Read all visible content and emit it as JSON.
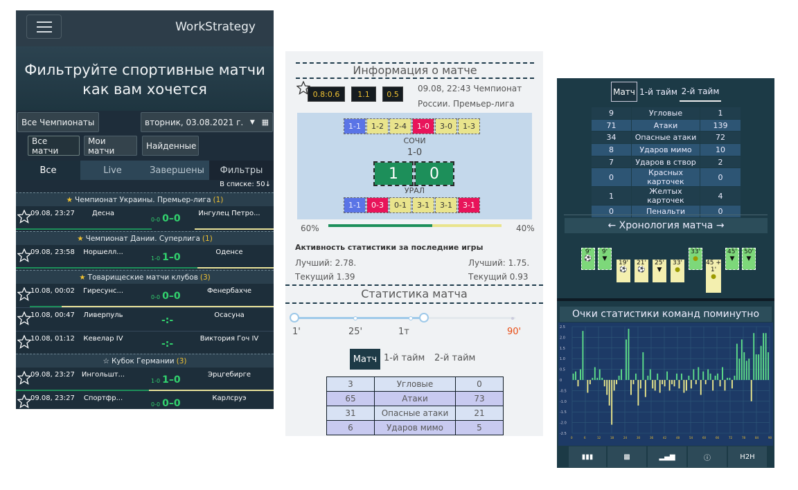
{
  "p1": {
    "brand": "WorkStrategy",
    "hero": [
      "Фильтруйте спортивные матчи",
      "как вам хочется"
    ],
    "championships": "Все Чемпионаты",
    "date": "вторник, 03.08.2021 г.",
    "mode_buttons": [
      "Все матчи",
      "Мои матчи",
      "Найденные"
    ],
    "tabs": [
      "Все",
      "Live",
      "Завершены",
      "Фильтры"
    ],
    "count": "В списке: 50",
    "leagues": [
      {
        "name": "Чемпионат Украины. Премьер-лига",
        "n": "(1)"
      },
      {
        "name": "Чемпионат Дании. Суперлига",
        "n": "(1)"
      },
      {
        "name": "Товарищеские матчи клубов",
        "n": "(3)"
      },
      {
        "name": "Кубок Германии",
        "n": "(3)"
      }
    ],
    "matches": [
      {
        "dt": "09.08, 23:27",
        "h": "Десна",
        "pre": "0-0",
        "sc": "0–0",
        "a": "Ингулец Петро..."
      },
      {
        "dt": "09.08, 23:58",
        "h": "Норшелл...",
        "pre": "1-0",
        "sc": "1–0",
        "a": "Оденсе"
      },
      {
        "dt": "10.08, 00:02",
        "h": "Гиресунс...",
        "pre": "0-0",
        "sc": "0–0",
        "a": "Фенербахче"
      },
      {
        "dt": "10.08, 00:47",
        "h": "Ливерпуль",
        "pre": "",
        "sc": "-:-",
        "a": "Осасуна"
      },
      {
        "dt": "10.08, 01:12",
        "h": "Кевелар IV",
        "pre": "",
        "sc": "-:-",
        "a": "Виктория Гоч IV"
      },
      {
        "dt": "09.08, 23:27",
        "h": "Ингольшт...",
        "pre": "1-0",
        "sc": "1–0",
        "a": "Эрцгебирге"
      },
      {
        "dt": "09.08, 23:27",
        "h": "Спортфр...",
        "pre": "0-0",
        "sc": "0–0",
        "a": "Карлсруэ"
      }
    ]
  },
  "p2": {
    "title1": "Информация о матче",
    "odds": [
      "0.8:0.6",
      "1.1",
      "0.5"
    ],
    "info": [
      "09.08, 22:43 Чемпионат",
      "России. Премьер-лига"
    ],
    "home_form": [
      "1-1",
      "1-2",
      "2-4",
      "1-0",
      "3-0",
      "1-3"
    ],
    "home": "СОЧИ",
    "score": "1-0",
    "big": [
      "1",
      "0"
    ],
    "away": "УРАЛ",
    "away_form": [
      "1-1",
      "0-3",
      "0-1",
      "3-1",
      "3-1",
      "3-1"
    ],
    "poss": [
      "60%",
      "40%"
    ],
    "activity": "Активность статистики за последние игры",
    "best": [
      "Лучший: 2.78.",
      "Лучший: 1.75."
    ],
    "current": [
      "Текущий 1.39",
      "Текущий 0.93"
    ],
    "title2": "Статистика матча",
    "timeline": [
      "1'",
      "25'",
      "1т",
      "90'"
    ],
    "tabs": [
      "Матч",
      "1-й тайм",
      "2-й тайм"
    ],
    "stats": [
      [
        "3",
        "Угловые",
        "0"
      ],
      [
        "65",
        "Атаки",
        "73"
      ],
      [
        "31",
        "Опасные атаки",
        "21"
      ],
      [
        "6",
        "Ударов мимо",
        "5"
      ]
    ]
  },
  "p3": {
    "tabs": [
      "Матч",
      "1-й тайм",
      "2-й тайм"
    ],
    "stats": [
      [
        "9",
        "Угловые",
        "1"
      ],
      [
        "71",
        "Атаки",
        "139"
      ],
      [
        "34",
        "Опасные атаки",
        "72"
      ],
      [
        "8",
        "Ударов мимо",
        "10"
      ],
      [
        "7",
        "Ударов в створ",
        "2"
      ],
      [
        "0",
        "Красных карточек",
        "0"
      ],
      [
        "1",
        "Желтых карточек",
        "4"
      ],
      [
        "0",
        "Пенальти",
        "0"
      ]
    ],
    "chrono": "Хронология матча",
    "events": {
      "top": [
        "9'",
        "9'",
        "33'",
        "45'",
        "50'"
      ],
      "bottom": [
        "19'",
        "21'",
        "25'",
        "33'",
        "45 +"
      ],
      "extra": "1'"
    },
    "chart_title": "Очки статистики команд поминутно",
    "bottom_bar": [
      "H2H"
    ],
    "chart_data": {
      "type": "bar",
      "ylim": [
        -2.5,
        2.5
      ],
      "yticks": [
        "2.5",
        "2.0",
        "1.5",
        "1.0",
        "0.5",
        "0",
        "-0.5",
        "-1.0",
        "-1.5",
        "-2.0",
        "-2.5"
      ],
      "series": [
        {
          "values": [
            0.3,
            0.4,
            -0.3,
            0.5,
            2.3,
            0,
            -0.6,
            -0.2,
            0.1,
            0.6,
            0.1,
            0.5,
            0.1,
            -0.3,
            -0.7,
            -1.2,
            -2.1,
            -0.5,
            -0.2,
            0.2,
            0.5,
            0,
            1.9,
            2.4,
            -0.7,
            -0.2,
            0.3,
            -1.2,
            -0.4,
            1.3,
            -0.8,
            0.2,
            0.5,
            -0.4,
            -0.5,
            0.3,
            -0.6,
            -0.2,
            -0.3,
            0.4,
            -0.5,
            -0.2,
            -0.3,
            0.3,
            -0.4,
            0.3,
            -0.6,
            -0.5,
            0.2,
            -0.4,
            0.5,
            -0.2,
            0.6,
            -0.7,
            0.4,
            -0.2,
            0.5,
            0.3,
            -0.5,
            0.2,
            0.3,
            -0.3,
            0.6,
            -0.5,
            0.1,
            0.1,
            -0.4,
            0.2,
            1.7,
            1.0,
            1.9,
            1.3,
            0.9,
            1.0,
            -1.0,
            2.2,
            1.2,
            1.2,
            1.6,
            2.2,
            2.2,
            1.3
          ]
        }
      ]
    }
  }
}
